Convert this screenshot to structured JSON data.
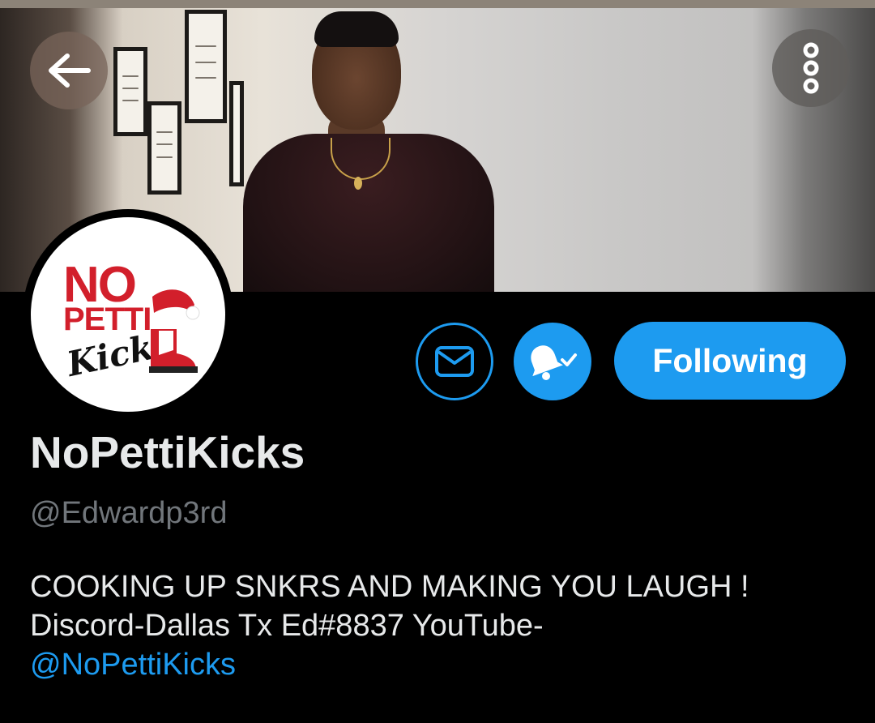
{
  "header": {
    "back_icon": "arrow-left-icon",
    "more_icon": "more-vertical-icon"
  },
  "avatar": {
    "logo_line1": "NO",
    "logo_line2": "PETTI",
    "logo_line3": "Kicks"
  },
  "actions": {
    "message_icon": "envelope-icon",
    "notify_icon": "bell-check-icon",
    "following_label": "Following"
  },
  "profile": {
    "display_name": "NoPettiKicks",
    "handle": "@Edwardp3rd",
    "bio_text": "COOKING UP SNKRS AND MAKING YOU LAUGH !  Discord-Dallas Tx Ed#8837 YouTube-",
    "bio_link": "@NoPettiKicks"
  },
  "colors": {
    "accent": "#1d9bf0",
    "background": "#000000",
    "text_primary": "#e7e9ea",
    "text_secondary": "#71767b",
    "logo_red": "#d21f2b"
  }
}
